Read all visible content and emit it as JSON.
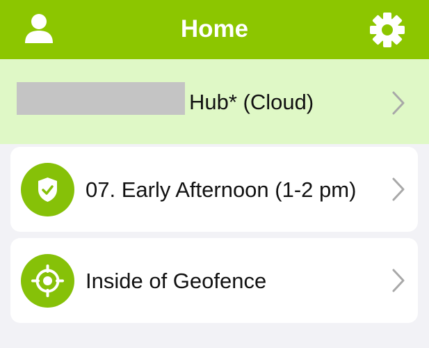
{
  "header": {
    "title": "Home",
    "background_color": "#8cc600",
    "left_icon": "user-profile-icon",
    "right_icon": "gear-icon"
  },
  "hub": {
    "label": "Hub* (Cloud)",
    "name_redacted": true,
    "background_color": "#dff8c6",
    "chevron_icon": "chevron-right-icon"
  },
  "cards": [
    {
      "label": "07. Early Afternoon (1-2 pm)",
      "icon": "shield-check-icon",
      "icon_color": "#86c108"
    },
    {
      "label": "Inside of Geofence",
      "icon": "geofence-crosshair-icon",
      "icon_color": "#86c108"
    }
  ]
}
